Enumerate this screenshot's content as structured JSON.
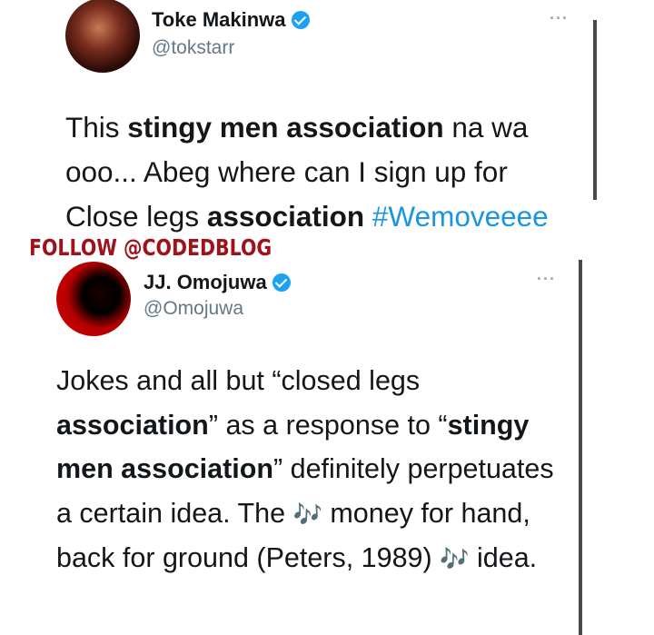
{
  "tweet1": {
    "name": "Toke Makinwa",
    "handle": "@tokstarr",
    "more": "···",
    "text": {
      "p1": "This ",
      "b1": "stingy men association",
      "p2": " na wa ooo... Abeg where can I sign up for Close legs ",
      "b2": "association",
      "p3": " ",
      "hashtag": "#Wemoveeee"
    }
  },
  "watermark": "FOLLOW @CODEDBLOG",
  "tweet2": {
    "name": "JJ. Omojuwa",
    "handle": "@Omojuwa",
    "more": "···",
    "text": {
      "p1": "Jokes and all but “closed legs ",
      "b1": "association",
      "p2": "” as a response to “",
      "b2": "stingy men association",
      "p3": "” definitely perpetuates a certain idea. The ",
      "emoji1": "🎶",
      "p4": " money for hand, back for ground (Peters, 1989) ",
      "emoji2": "🎶",
      "p5": " idea."
    }
  },
  "colors": {
    "verified": "#1da1f2",
    "hashtag": "#1b95e0",
    "watermark": "#a0111a",
    "handle": "#657786"
  },
  "icons": [
    "verified-badge-icon",
    "more-options-icon",
    "musical-notes-icon"
  ]
}
